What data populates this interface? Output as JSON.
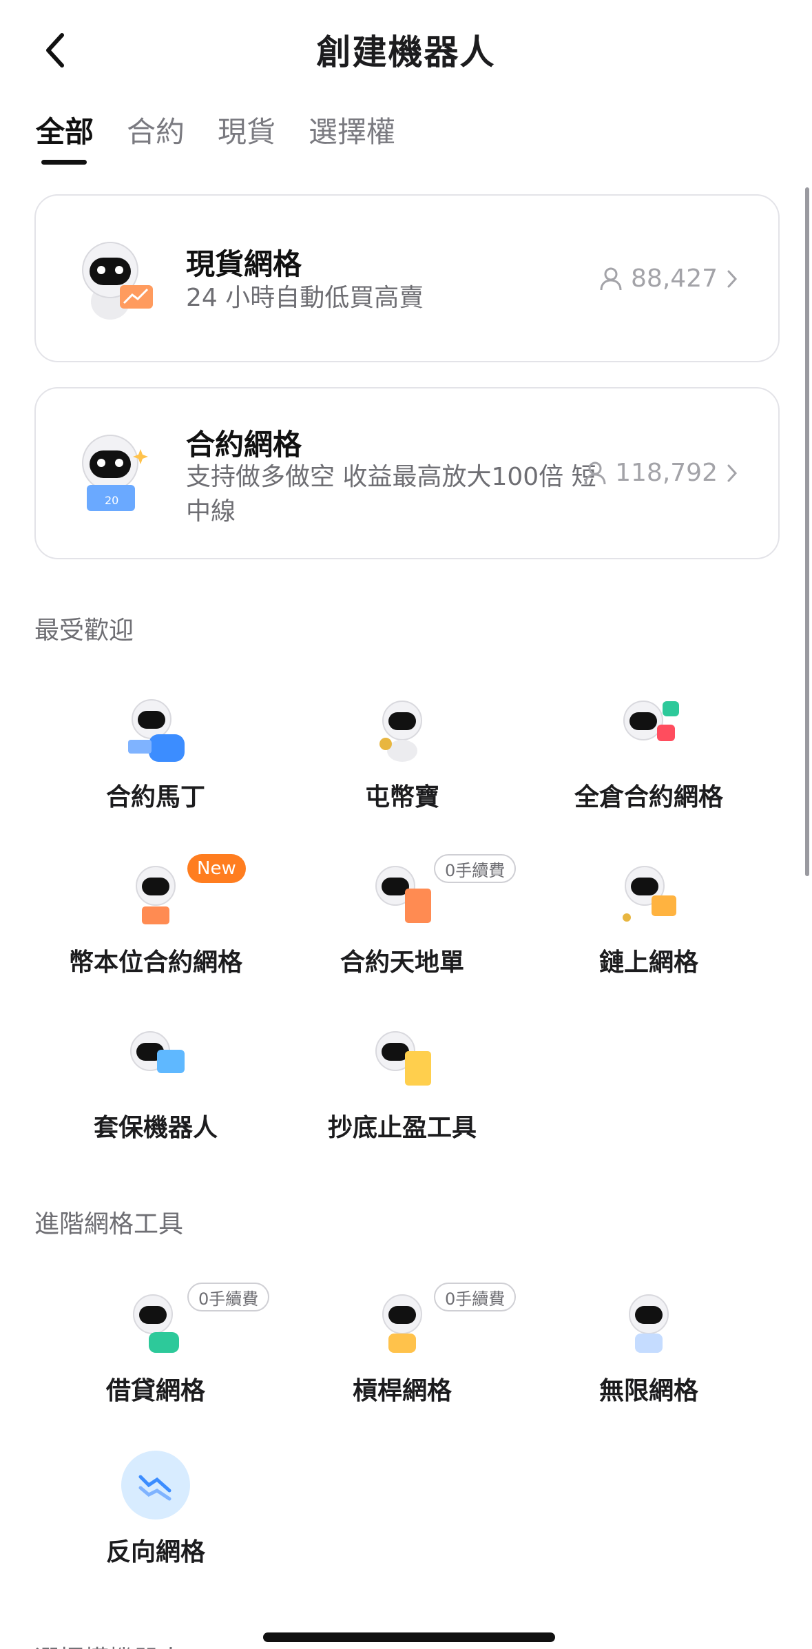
{
  "header": {
    "title": "創建機器人"
  },
  "tabs": [
    {
      "label": "全部"
    },
    {
      "label": "合約"
    },
    {
      "label": "現貨"
    },
    {
      "label": "選擇權"
    }
  ],
  "cards": [
    {
      "title": "現貨網格",
      "desc": "24 小時自動低買高賣",
      "users": "88,427"
    },
    {
      "title": "合約網格",
      "desc": "支持做多做空 收益最高放大100倍 短中線",
      "users": "118,792"
    }
  ],
  "popular": {
    "title": "最受歡迎",
    "items": [
      {
        "label": "合約馬丁"
      },
      {
        "label": "屯幣寶"
      },
      {
        "label": "全倉合約網格"
      },
      {
        "label": "幣本位合約網格",
        "badge": "New"
      },
      {
        "label": "合約天地單",
        "badge": "0手續費"
      },
      {
        "label": "鏈上網格"
      },
      {
        "label": "套保機器人"
      },
      {
        "label": "抄底止盈工具"
      }
    ]
  },
  "advanced": {
    "title": "進階網格工具",
    "items": [
      {
        "label": "借貸網格",
        "badge": "0手續費"
      },
      {
        "label": "槓桿網格",
        "badge": "0手續費"
      },
      {
        "label": "無限網格"
      },
      {
        "label": "反向網格"
      }
    ]
  },
  "next_section": {
    "title": "選擇權機器人"
  },
  "colors": {
    "new_badge": "#ff7d1f",
    "accent_blue": "#3c8dff",
    "text_primary": "#111111",
    "text_secondary": "#6e6e73"
  },
  "icons": [
    "back-chevron-icon",
    "user-icon",
    "chevron-right-icon",
    "robot-mascot-icon",
    "reverse-grid-icon"
  ]
}
